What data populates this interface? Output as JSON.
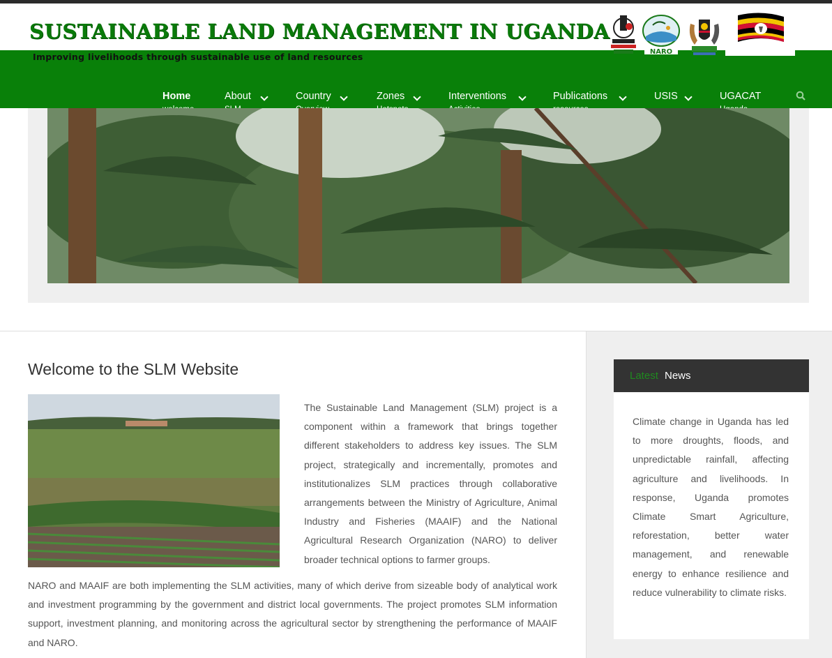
{
  "header": {
    "title": "SUSTAINABLE LAND MANAGEMENT IN UGANDA",
    "tagline": "Improving livelihoods through sustainable use of land resources",
    "logos": [
      "research-institute-logo",
      "naro-logo",
      "uganda-coat-of-arms",
      "uganda-flag"
    ],
    "naro_text": "NARO"
  },
  "nav": {
    "items": [
      {
        "label": "Home",
        "sub": "welcome",
        "active": true
      },
      {
        "label": "About",
        "sub": "SLM"
      },
      {
        "label": "Country",
        "sub": "Overview"
      },
      {
        "label": "Zones",
        "sub": "Hotspots"
      },
      {
        "label": "Interventions",
        "sub": "Activities"
      },
      {
        "label": "Publications",
        "sub": "resources"
      },
      {
        "label": "USIS",
        "sub": ""
      },
      {
        "label": "UGACAT",
        "sub": "Uganda"
      }
    ],
    "search_icon": "search-icon"
  },
  "main": {
    "title": "Welcome to the SLM Website",
    "intro": "The Sustainable Land Management (SLM) project is a component within a framework that brings together different stakeholders to address key issues. The SLM project, strategically and incrementally, promotes and institutionalizes SLM practices through collaborative arrangements between the Ministry of Agriculture, Animal Industry and Fisheries (MAAIF) and the National Agricultural Research Organization (NARO) to deliver broader technical options to farmer groups.",
    "body": "NARO and MAAIF are both implementing the SLM activities, many of which derive from sizeable body of analytical work and investment programming by the government and district local governments. The project promotes SLM information support, investment planning, and monitoring across the agricultural sector by strengthening the performance of MAAIF and NARO."
  },
  "sidebar": {
    "heading_accent": "Latest",
    "heading_main": "News",
    "news_text": "Climate change in Uganda has led to more droughts, floods, and unpredictable rainfall, affecting agriculture and livelihoods. In response, Uganda promotes Climate Smart Agriculture, reforestation, better water management, and renewable energy to enhance resilience and reduce vulnerability to climate risks."
  },
  "colors": {
    "brand_green": "#098009",
    "accent_green": "#1f8a1f",
    "dark_panel": "#333333",
    "text_gray": "#555555"
  }
}
